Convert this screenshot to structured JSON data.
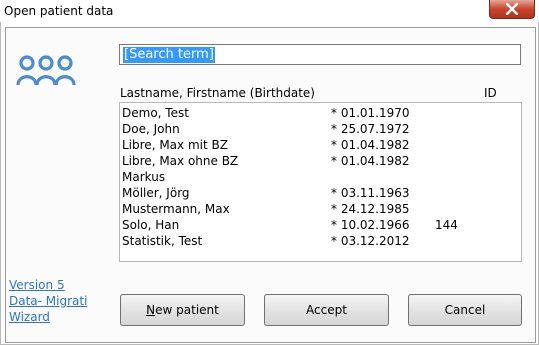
{
  "window": {
    "title": "Open patient data",
    "close_icon": "close-icon"
  },
  "search": {
    "value": "[Search term]"
  },
  "list": {
    "header_name": "Lastname, Firstname (Birthdate)",
    "header_id": "ID",
    "rows": [
      {
        "name": "Demo, Test",
        "birth": "* 01.01.1970",
        "id": ""
      },
      {
        "name": "Doe, John",
        "birth": "* 25.07.1972",
        "id": ""
      },
      {
        "name": "Libre, Max mit BZ",
        "birth": "* 01.04.1982",
        "id": ""
      },
      {
        "name": "Libre, Max ohne BZ",
        "birth": "* 01.04.1982",
        "id": ""
      },
      {
        "name": "Markus",
        "birth": "",
        "id": ""
      },
      {
        "name": "Möller, Jörg",
        "birth": "* 03.11.1963",
        "id": ""
      },
      {
        "name": "Mustermann, Max",
        "birth": "* 24.12.1985",
        "id": ""
      },
      {
        "name": "Solo, Han",
        "birth": "* 10.02.1966",
        "id": "144"
      },
      {
        "name": "Statistik, Test",
        "birth": "* 03.12.2012",
        "id": ""
      }
    ]
  },
  "links": {
    "version": "Version 5",
    "migration_line1": "Data- Migrati",
    "migration_line2": "Wizard"
  },
  "buttons": {
    "new_patient_first": "N",
    "new_patient_rest": "ew patient",
    "accept": "Accept",
    "cancel": "Cancel"
  },
  "colors": {
    "icon_blue": "#4a8bd6",
    "link_blue": "#2e74c4",
    "selection": "#3399ff",
    "close_red": "#c7442e"
  }
}
